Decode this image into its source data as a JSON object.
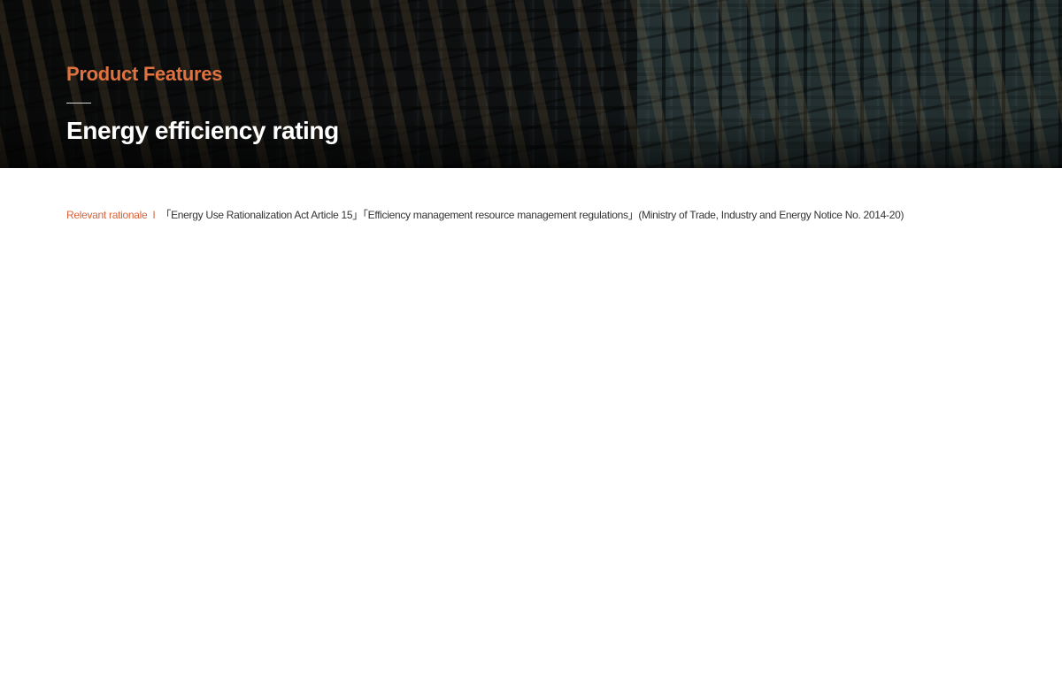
{
  "hero": {
    "eyebrow": "Product Features",
    "title": "Energy efficiency rating"
  },
  "rationale": {
    "label": "Relevant rationale",
    "separator": "I",
    "text": "「Energy Use Rationalization Act Article 15」「Efficiency management resource management regulations」(Ministry of Trade, Industry and Energy Notice No. 2014-20)"
  },
  "colors": {
    "accent": "#e0723f",
    "body_text": "#333333",
    "hero_text": "#ffffff"
  }
}
